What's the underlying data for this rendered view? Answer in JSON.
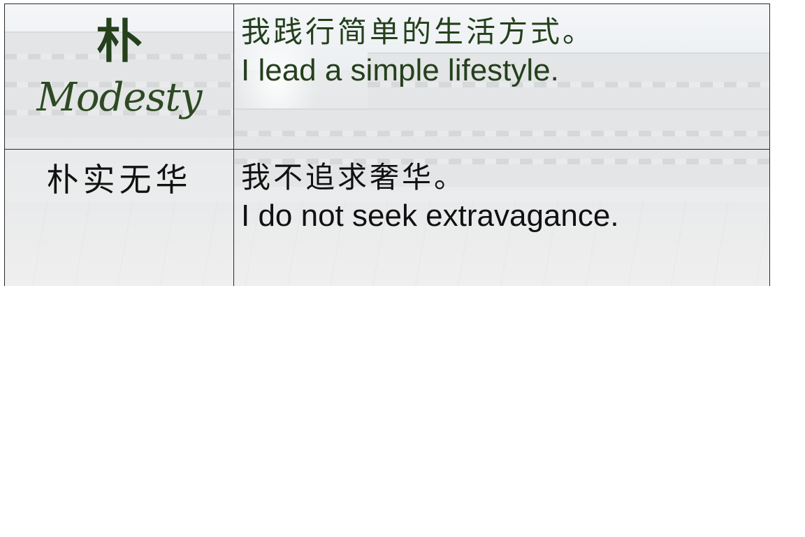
{
  "virtue": {
    "title_zh": "朴",
    "title_en": "Modesty"
  },
  "rows": [
    {
      "statement_zh": "我践行简单的生活方式。",
      "statement_en": "I lead a simple lifestyle."
    },
    {
      "phrase_zh": "朴实无华",
      "statement_zh": "我不追求奢华。",
      "statement_en": "I do not seek extravagance."
    }
  ],
  "colors": {
    "accent_green": "#24401c",
    "text_black": "#111111",
    "border": "#2a2a2a"
  }
}
